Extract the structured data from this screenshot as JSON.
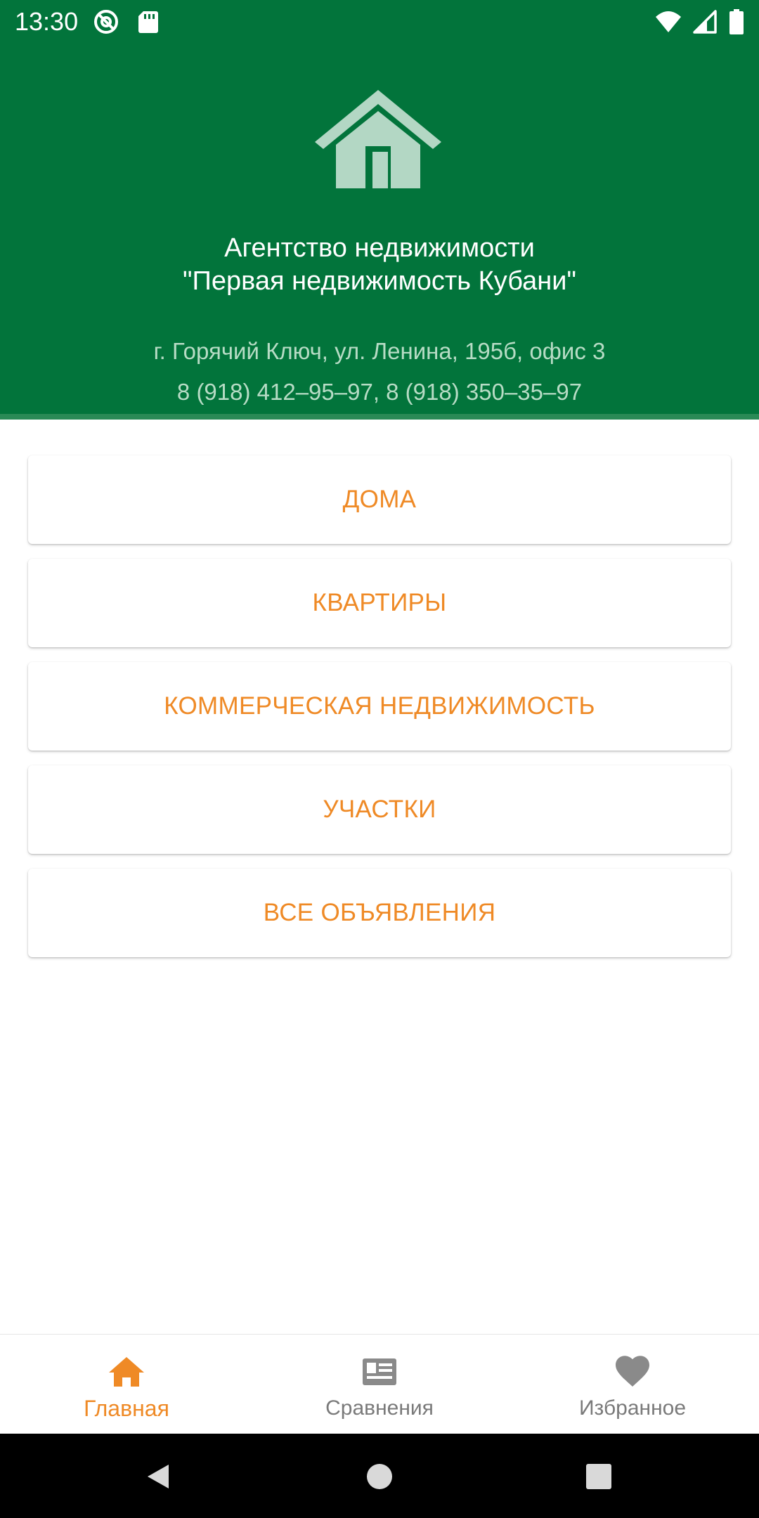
{
  "status_bar": {
    "time": "13:30",
    "left_icons": [
      "do-not-disturb-icon",
      "sd-card-icon"
    ],
    "right_icons": [
      "wifi-icon",
      "cell-signal-icon",
      "battery-icon"
    ]
  },
  "header": {
    "logo_icon": "house-icon",
    "title_line1": "Агентство недвижимости",
    "title_line2": "\"Первая недвижимость Кубани\"",
    "address": "г. Горячий Ключ, ул. Ленина, 195б, офис 3",
    "phones": "8 (918) 412–95–97, 8 (918) 350–35–97"
  },
  "menu": {
    "items": [
      {
        "label": "ДОМА"
      },
      {
        "label": "КВАРТИРЫ"
      },
      {
        "label": "КОММЕРЧЕСКАЯ НЕДВИЖИМОСТЬ"
      },
      {
        "label": "УЧАСТКИ"
      },
      {
        "label": "ВСЕ ОБЪЯВЛЕНИЯ"
      }
    ]
  },
  "bottom_nav": {
    "items": [
      {
        "label": "Главная",
        "icon": "home-icon",
        "active": true
      },
      {
        "label": "Сравнения",
        "icon": "compare-icon",
        "active": false
      },
      {
        "label": "Избранное",
        "icon": "heart-icon",
        "active": false
      }
    ]
  },
  "colors": {
    "header_green": "#02743b",
    "accent_orange": "#ef8a26",
    "inactive_grey": "#7a7a7a",
    "subtitle_green": "#b7dcc5"
  }
}
